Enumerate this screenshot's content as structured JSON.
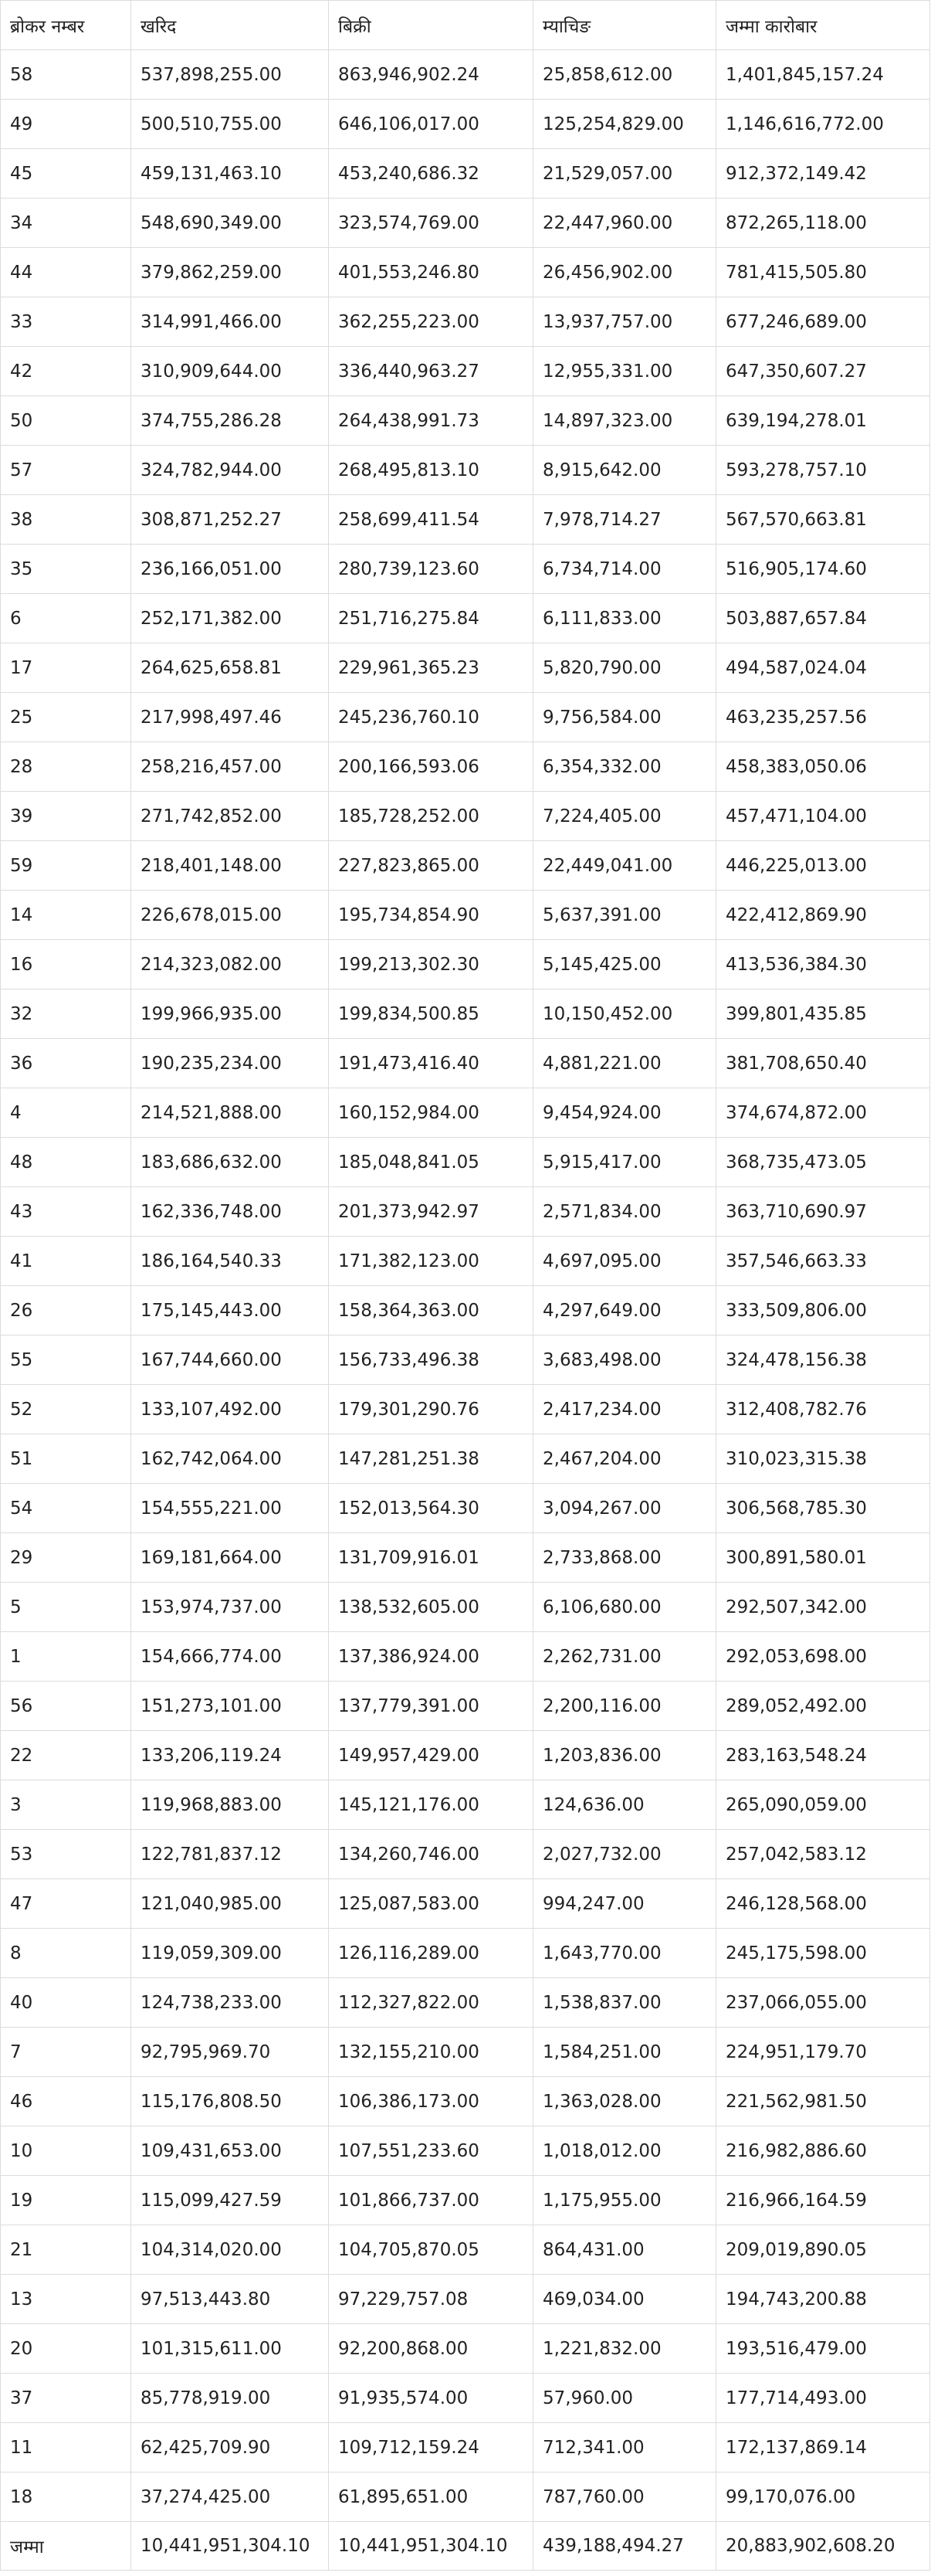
{
  "table": {
    "headers": [
      "ब्रोकर नम्बर",
      "खरिद",
      "बिक्री",
      "म्याचिङ",
      "जम्मा कारोबार"
    ],
    "rows": [
      [
        "58",
        "537,898,255.00",
        "863,946,902.24",
        "25,858,612.00",
        "1,401,845,157.24"
      ],
      [
        "49",
        "500,510,755.00",
        "646,106,017.00",
        "125,254,829.00",
        "1,146,616,772.00"
      ],
      [
        "45",
        "459,131,463.10",
        "453,240,686.32",
        "21,529,057.00",
        "912,372,149.42"
      ],
      [
        "34",
        "548,690,349.00",
        "323,574,769.00",
        "22,447,960.00",
        "872,265,118.00"
      ],
      [
        "44",
        "379,862,259.00",
        "401,553,246.80",
        "26,456,902.00",
        "781,415,505.80"
      ],
      [
        "33",
        "314,991,466.00",
        "362,255,223.00",
        "13,937,757.00",
        "677,246,689.00"
      ],
      [
        "42",
        "310,909,644.00",
        "336,440,963.27",
        "12,955,331.00",
        "647,350,607.27"
      ],
      [
        "50",
        "374,755,286.28",
        "264,438,991.73",
        "14,897,323.00",
        "639,194,278.01"
      ],
      [
        "57",
        "324,782,944.00",
        "268,495,813.10",
        "8,915,642.00",
        "593,278,757.10"
      ],
      [
        "38",
        "308,871,252.27",
        "258,699,411.54",
        "7,978,714.27",
        "567,570,663.81"
      ],
      [
        "35",
        "236,166,051.00",
        "280,739,123.60",
        "6,734,714.00",
        "516,905,174.60"
      ],
      [
        "6",
        "252,171,382.00",
        "251,716,275.84",
        "6,111,833.00",
        "503,887,657.84"
      ],
      [
        "17",
        "264,625,658.81",
        "229,961,365.23",
        "5,820,790.00",
        "494,587,024.04"
      ],
      [
        "25",
        "217,998,497.46",
        "245,236,760.10",
        "9,756,584.00",
        "463,235,257.56"
      ],
      [
        "28",
        "258,216,457.00",
        "200,166,593.06",
        "6,354,332.00",
        "458,383,050.06"
      ],
      [
        "39",
        "271,742,852.00",
        "185,728,252.00",
        "7,224,405.00",
        "457,471,104.00"
      ],
      [
        "59",
        "218,401,148.00",
        "227,823,865.00",
        "22,449,041.00",
        "446,225,013.00"
      ],
      [
        "14",
        "226,678,015.00",
        "195,734,854.90",
        "5,637,391.00",
        "422,412,869.90"
      ],
      [
        "16",
        "214,323,082.00",
        "199,213,302.30",
        "5,145,425.00",
        "413,536,384.30"
      ],
      [
        "32",
        "199,966,935.00",
        "199,834,500.85",
        "10,150,452.00",
        "399,801,435.85"
      ],
      [
        "36",
        "190,235,234.00",
        "191,473,416.40",
        "4,881,221.00",
        "381,708,650.40"
      ],
      [
        "4",
        "214,521,888.00",
        "160,152,984.00",
        "9,454,924.00",
        "374,674,872.00"
      ],
      [
        "48",
        "183,686,632.00",
        "185,048,841.05",
        "5,915,417.00",
        "368,735,473.05"
      ],
      [
        "43",
        "162,336,748.00",
        "201,373,942.97",
        "2,571,834.00",
        "363,710,690.97"
      ],
      [
        "41",
        "186,164,540.33",
        "171,382,123.00",
        "4,697,095.00",
        "357,546,663.33"
      ],
      [
        "26",
        "175,145,443.00",
        "158,364,363.00",
        "4,297,649.00",
        "333,509,806.00"
      ],
      [
        "55",
        "167,744,660.00",
        "156,733,496.38",
        "3,683,498.00",
        "324,478,156.38"
      ],
      [
        "52",
        "133,107,492.00",
        "179,301,290.76",
        "2,417,234.00",
        "312,408,782.76"
      ],
      [
        "51",
        "162,742,064.00",
        "147,281,251.38",
        "2,467,204.00",
        "310,023,315.38"
      ],
      [
        "54",
        "154,555,221.00",
        "152,013,564.30",
        "3,094,267.00",
        "306,568,785.30"
      ],
      [
        "29",
        "169,181,664.00",
        "131,709,916.01",
        "2,733,868.00",
        "300,891,580.01"
      ],
      [
        "5",
        "153,974,737.00",
        "138,532,605.00",
        "6,106,680.00",
        "292,507,342.00"
      ],
      [
        "1",
        "154,666,774.00",
        "137,386,924.00",
        "2,262,731.00",
        "292,053,698.00"
      ],
      [
        "56",
        "151,273,101.00",
        "137,779,391.00",
        "2,200,116.00",
        "289,052,492.00"
      ],
      [
        "22",
        "133,206,119.24",
        "149,957,429.00",
        "1,203,836.00",
        "283,163,548.24"
      ],
      [
        "3",
        "119,968,883.00",
        "145,121,176.00",
        "124,636.00",
        "265,090,059.00"
      ],
      [
        "53",
        "122,781,837.12",
        "134,260,746.00",
        "2,027,732.00",
        "257,042,583.12"
      ],
      [
        "47",
        "121,040,985.00",
        "125,087,583.00",
        "994,247.00",
        "246,128,568.00"
      ],
      [
        "8",
        "119,059,309.00",
        "126,116,289.00",
        "1,643,770.00",
        "245,175,598.00"
      ],
      [
        "40",
        "124,738,233.00",
        "112,327,822.00",
        "1,538,837.00",
        "237,066,055.00"
      ],
      [
        "7",
        "92,795,969.70",
        "132,155,210.00",
        "1,584,251.00",
        "224,951,179.70"
      ],
      [
        "46",
        "115,176,808.50",
        "106,386,173.00",
        "1,363,028.00",
        "221,562,981.50"
      ],
      [
        "10",
        "109,431,653.00",
        "107,551,233.60",
        "1,018,012.00",
        "216,982,886.60"
      ],
      [
        "19",
        "115,099,427.59",
        "101,866,737.00",
        "1,175,955.00",
        "216,966,164.59"
      ],
      [
        "21",
        "104,314,020.00",
        "104,705,870.05",
        "864,431.00",
        "209,019,890.05"
      ],
      [
        "13",
        "97,513,443.80",
        "97,229,757.08",
        "469,034.00",
        "194,743,200.88"
      ],
      [
        "20",
        "101,315,611.00",
        "92,200,868.00",
        "1,221,832.00",
        "193,516,479.00"
      ],
      [
        "37",
        "85,778,919.00",
        "91,935,574.00",
        "57,960.00",
        "177,714,493.00"
      ],
      [
        "11",
        "62,425,709.90",
        "109,712,159.24",
        "712,341.00",
        "172,137,869.14"
      ],
      [
        "18",
        "37,274,425.00",
        "61,895,651.00",
        "787,760.00",
        "99,170,076.00"
      ]
    ],
    "total": [
      "जम्मा",
      "10,441,951,304.10",
      "10,441,951,304.10",
      "439,188,494.27",
      "20,883,902,608.20"
    ]
  },
  "colors": {
    "border": "#dcdcdc",
    "text": "#222222",
    "background": "#ffffff"
  }
}
